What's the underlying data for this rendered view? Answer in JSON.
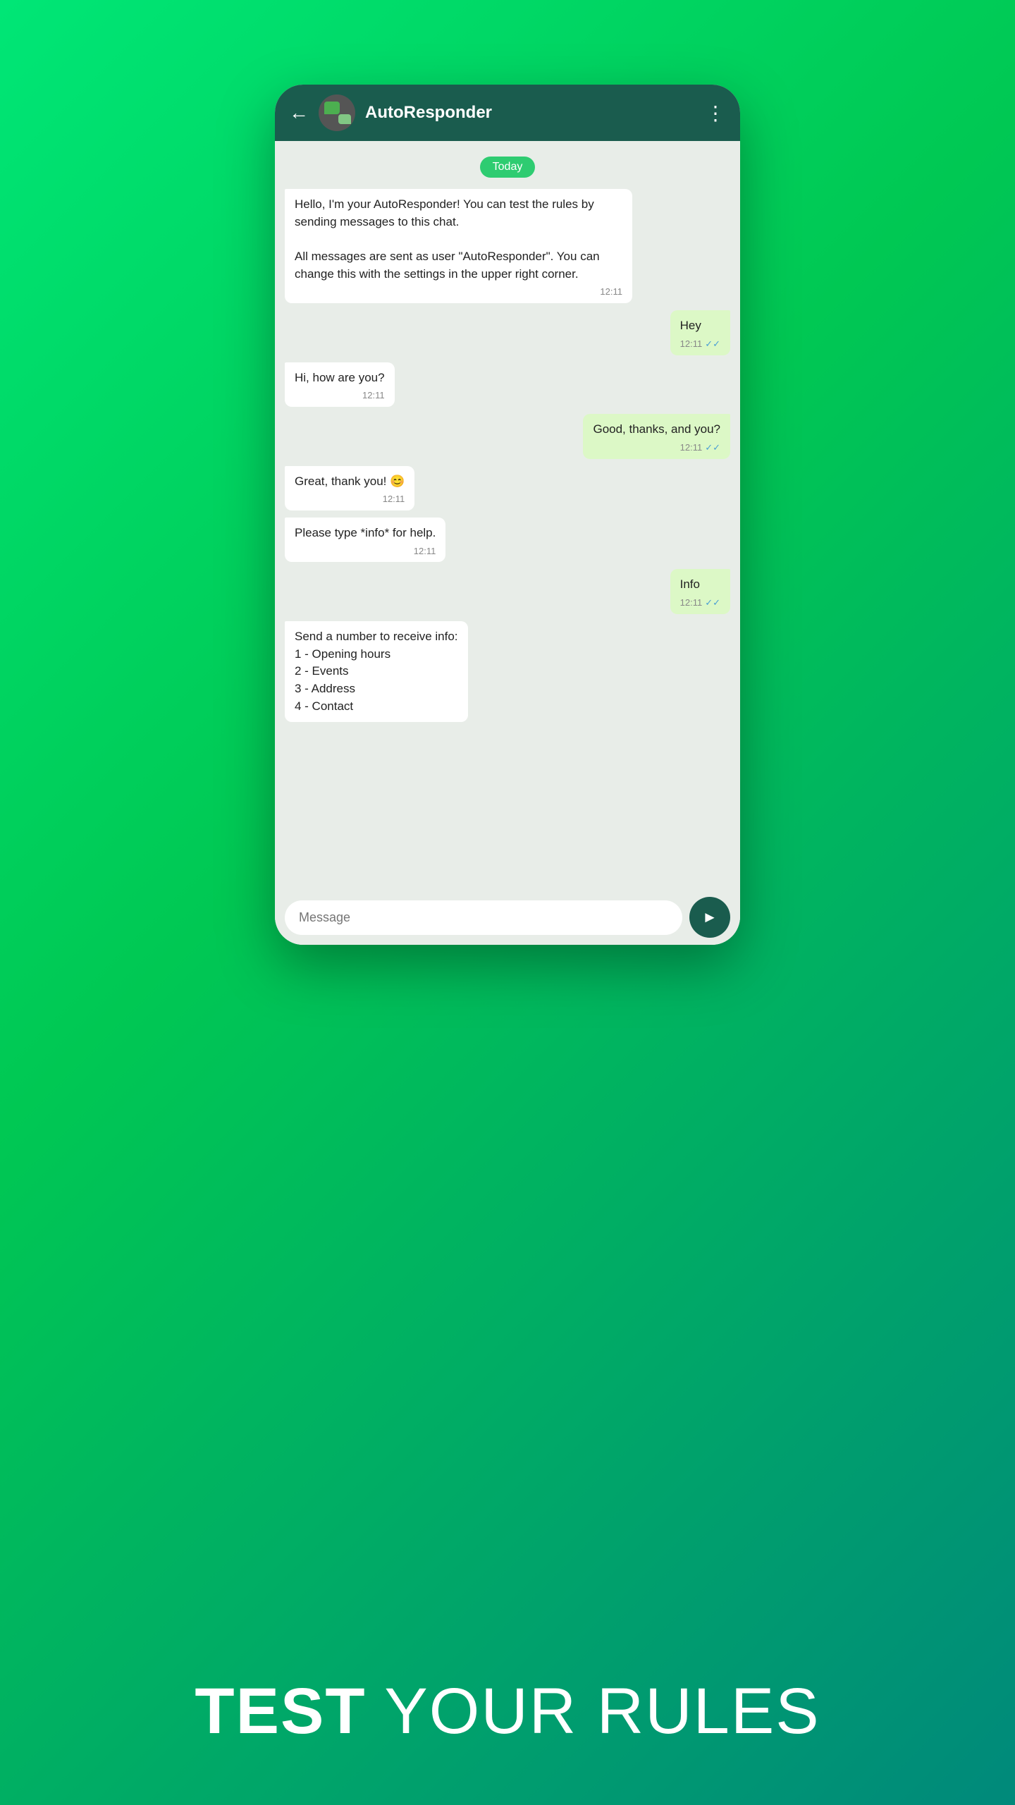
{
  "background": {
    "gradient_start": "#00e676",
    "gradient_end": "#00897b"
  },
  "header": {
    "title": "AutoResponder",
    "back_label": "←",
    "more_label": "⋮"
  },
  "chat": {
    "date_badge": "Today",
    "messages": [
      {
        "id": "msg1",
        "type": "incoming",
        "text": "Hello, I'm your AutoResponder! You can test the rules by sending messages to this chat.\n\nAll messages are sent as user \"AutoResponder\". You can change this with the settings in the upper right corner.",
        "time": "12:11",
        "has_check": false
      },
      {
        "id": "msg2",
        "type": "outgoing",
        "text": "Hey",
        "time": "12:11",
        "has_check": true
      },
      {
        "id": "msg3",
        "type": "incoming",
        "text": "Hi, how are you?",
        "time": "12:11",
        "has_check": false
      },
      {
        "id": "msg4",
        "type": "outgoing",
        "text": "Good, thanks, and you?",
        "time": "12:11",
        "has_check": true
      },
      {
        "id": "msg5",
        "type": "incoming",
        "text": "Great, thank you! 😊",
        "time": "12:11",
        "has_check": false
      },
      {
        "id": "msg6",
        "type": "incoming",
        "text": "Please type *info* for help.",
        "time": "12:11",
        "has_check": false
      },
      {
        "id": "msg7",
        "type": "outgoing",
        "text": "Info",
        "time": "12:11",
        "has_check": true
      },
      {
        "id": "msg8",
        "type": "incoming",
        "text": "Send a number to receive info:\n1 - Opening hours\n2 - Events\n3 - Address\n4 - Contact",
        "time": "",
        "has_check": false
      }
    ]
  },
  "input": {
    "placeholder": "Message"
  },
  "bottom_text": {
    "bold": "TEST",
    "light": " YOUR RULES"
  }
}
